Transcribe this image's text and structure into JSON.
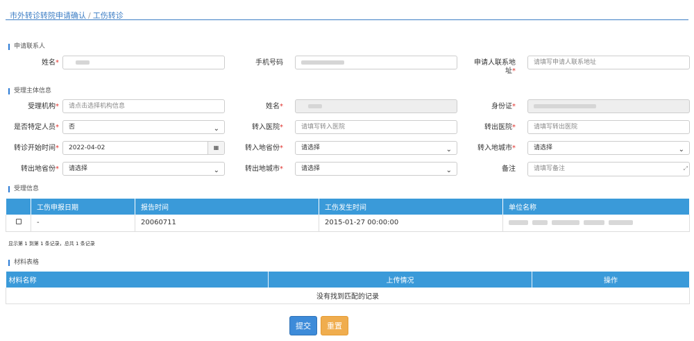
{
  "breadcrumb": {
    "parent": "市外转诊转院申请确认",
    "separator": "/",
    "current": "工伤转诊"
  },
  "sections": {
    "contact": "申请联系人",
    "subject": "受理主体信息",
    "accept": "受理信息",
    "materials": "材料表格"
  },
  "contact": {
    "name_label": "姓名",
    "phone_label": "手机号码",
    "address_label_1": "申请人联系地",
    "address_label_2": "址",
    "address_placeholder": "请填写申请人联系地址"
  },
  "subject": {
    "org_label": "受理机构",
    "org_placeholder": "请点击选择机构信息",
    "name_label": "姓名",
    "id_label": "身份证",
    "special_label": "是否特定人员",
    "special_value": "否",
    "in_hospital_label": "转入医院",
    "in_hospital_placeholder": "请填写转入医院",
    "out_hospital_label": "转出医院",
    "out_hospital_placeholder": "请填写转出医院",
    "start_label": "转诊开始时间",
    "start_value": "2022-04-02",
    "in_province_label": "转入地省份",
    "in_province_value": "请选择",
    "in_city_label": "转入地城市",
    "in_city_value": "请选择",
    "out_province_label": "转出地省份",
    "out_province_value": "请选择",
    "out_city_label": "转出地城市",
    "out_city_value": "请选择",
    "remark_label": "备注",
    "remark_placeholder": "请填写备注"
  },
  "required_mark": "*",
  "accept_table": {
    "headers": [
      "",
      "工伤申报日期",
      "报告时间",
      "工伤发生时间",
      "单位名称"
    ],
    "rows": [
      {
        "declare_date": "-",
        "report_time": "20060711",
        "occur_time": "2015-01-27 00:00:00"
      }
    ],
    "page_info": "显示第 1 到第 1 条记录，总共 1 条记录"
  },
  "materials_table": {
    "headers": [
      "材料名称",
      "上传情况",
      "操作"
    ],
    "empty_text": "没有找到匹配的记录"
  },
  "buttons": {
    "submit": "提交",
    "reset": "重置"
  }
}
